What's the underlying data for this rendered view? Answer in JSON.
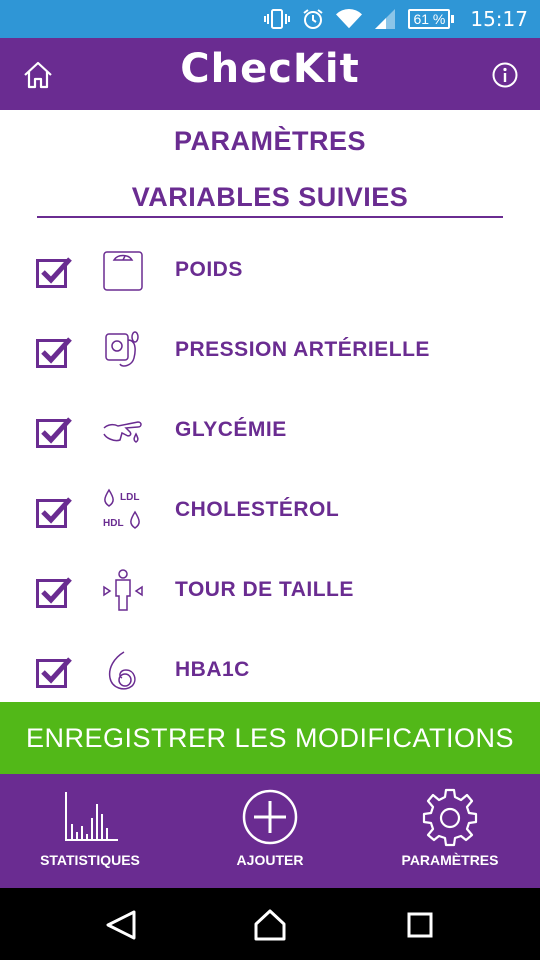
{
  "status_bar": {
    "battery": "61 %",
    "time": "15:17",
    "icons": [
      "vibrate-icon",
      "alarm-icon",
      "wifi-icon",
      "signal-icon"
    ]
  },
  "header": {
    "brand": "ChecKit",
    "home_icon": "home-icon",
    "info_icon": "info-icon"
  },
  "page": {
    "title": "PARAMÈTRES",
    "section_title": "VARIABLES SUIVIES"
  },
  "variables": [
    {
      "label": "POIDS",
      "icon": "scale-icon",
      "checked": true
    },
    {
      "label": "PRESSION ARTÉRIELLE",
      "icon": "blood-pressure-icon",
      "checked": true
    },
    {
      "label": "GLYCÉMIE",
      "icon": "finger-drop-icon",
      "checked": true
    },
    {
      "label": "CHOLESTÉROL",
      "icon": "cholesterol-icon",
      "checked": true,
      "icon_text": [
        "LDL",
        "HDL"
      ]
    },
    {
      "label": "TOUR DE TAILLE",
      "icon": "waist-icon",
      "checked": true
    },
    {
      "label": "HBA1C",
      "icon": "hba1c-icon",
      "checked": true
    }
  ],
  "save_button": {
    "label": "ENREGISTRER LES MODIFICATIONS"
  },
  "bottom_nav": [
    {
      "label": "STATISTIQUES",
      "icon": "statistics-icon"
    },
    {
      "label": "AJOUTER",
      "icon": "add-icon"
    },
    {
      "label": "PARAMÈTRES",
      "icon": "settings-gear-icon"
    }
  ],
  "colors": {
    "status_bar": "#2f96d6",
    "brand_purple": "#6a2c91",
    "save_green": "#52b818"
  }
}
